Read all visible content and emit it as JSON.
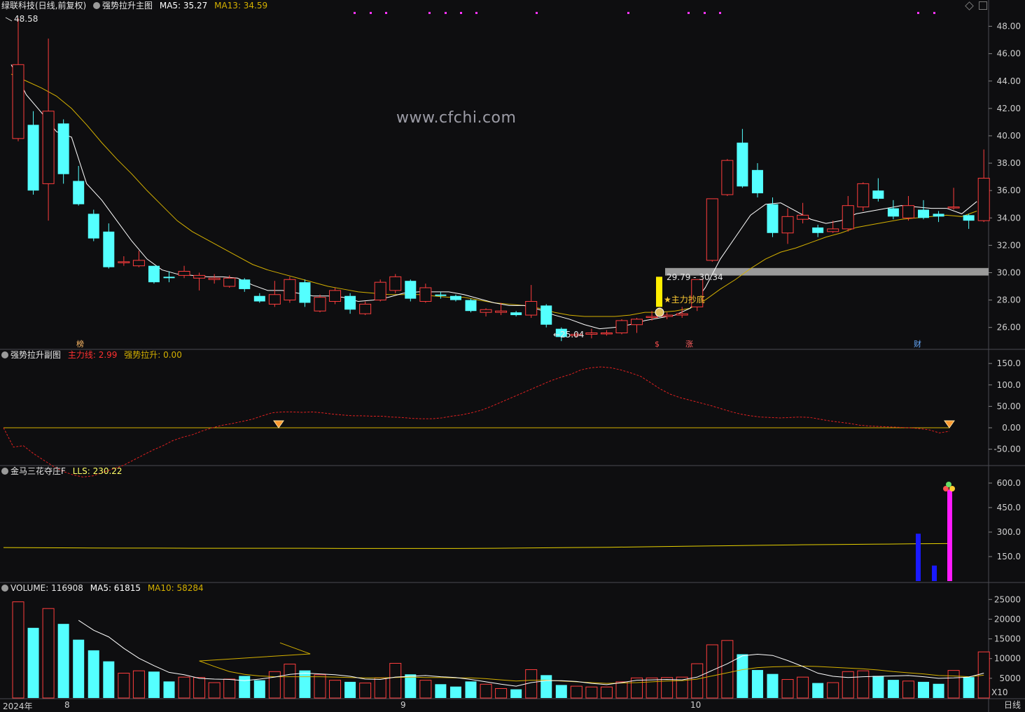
{
  "main_header": {
    "title": "绿联科技(日线,前复权)",
    "indicator": "强势拉升主图",
    "ma5": "MA5: 35.27",
    "ma13": "MA13: 34.59"
  },
  "sub1_header": {
    "title": "强势拉升副图",
    "line1": "主力线: 2.99",
    "line2": "强势拉升: 0.00"
  },
  "sub2_header": {
    "title": "金马三花夺庄F",
    "lls": "LLS: 230.22"
  },
  "vol_header": {
    "title": "VOLUME: 116908",
    "ma5": "MA5: 61815",
    "ma10": "MA10: 58284"
  },
  "watermark": "www.cfchi.com",
  "annotations": {
    "high": "48.58",
    "low": "25.04",
    "range": "29.79 - 30.34",
    "signal": "主力抄底",
    "mark_bang": "榜",
    "mark_s": "$",
    "mark_zhang": "涨",
    "mark_cai": "财"
  },
  "x_axis": {
    "year": "2024年",
    "m8": "8",
    "m9": "9",
    "m10": "10",
    "zoom": "X10",
    "period": "日线"
  },
  "axes": {
    "main": [
      "48.00",
      "46.00",
      "44.00",
      "42.00",
      "40.00",
      "38.00",
      "36.00",
      "34.00",
      "32.00",
      "30.00",
      "28.00",
      "26.00"
    ],
    "sub1": [
      "150.0",
      "100.0",
      "50.00",
      "0.00",
      "-50.00"
    ],
    "sub2": [
      "600.0",
      "450.0",
      "300.0",
      "150.0"
    ],
    "vol": [
      "25000",
      "20000",
      "15000",
      "10000",
      "5000"
    ]
  },
  "colors": {
    "up": "#ff3d3d",
    "down": "#54ffff",
    "ma5": "#ffffff",
    "ma13": "#d4b000",
    "bg": "#0e0e10",
    "grid": "#3a3a44"
  },
  "chart_data": {
    "type": "candlestick",
    "price_range": [
      24.5,
      49.0
    ],
    "candles": [
      [
        39.8,
        45.2,
        48.6,
        39.6
      ],
      [
        40.8,
        36.0,
        41.8,
        35.7
      ],
      [
        36.5,
        41.8,
        47.1,
        33.8
      ],
      [
        40.9,
        37.2,
        41.2,
        36.5
      ],
      [
        36.7,
        35.0,
        37.8,
        34.9
      ],
      [
        34.3,
        32.5,
        34.6,
        32.3
      ],
      [
        33.0,
        30.4,
        33.6,
        30.3
      ],
      [
        30.8,
        30.8,
        31.2,
        30.5
      ],
      [
        30.5,
        30.9,
        31.6,
        30.4
      ],
      [
        30.5,
        29.3,
        30.5,
        29.2
      ],
      [
        29.7,
        29.6,
        30.1,
        29.3
      ],
      [
        29.8,
        30.1,
        30.5,
        29.6
      ],
      [
        29.6,
        29.8,
        30.0,
        28.7
      ],
      [
        29.5,
        29.6,
        29.9,
        29.2
      ],
      [
        29.0,
        29.6,
        29.8,
        28.9
      ],
      [
        29.5,
        28.8,
        29.6,
        28.6
      ],
      [
        28.3,
        27.9,
        28.5,
        27.8
      ],
      [
        27.7,
        28.4,
        29.4,
        27.5
      ],
      [
        28.0,
        29.5,
        29.7,
        27.8
      ],
      [
        29.3,
        27.8,
        29.5,
        27.5
      ],
      [
        27.2,
        28.2,
        28.4,
        27.1
      ],
      [
        27.9,
        28.7,
        28.9,
        27.7
      ],
      [
        28.3,
        27.3,
        28.5,
        27.0
      ],
      [
        27.0,
        27.7,
        27.9,
        26.9
      ],
      [
        28.0,
        29.3,
        29.5,
        27.9
      ],
      [
        28.7,
        29.7,
        29.9,
        28.5
      ],
      [
        29.4,
        28.1,
        29.5,
        27.9
      ],
      [
        27.9,
        28.9,
        29.2,
        27.8
      ],
      [
        28.4,
        28.3,
        28.6,
        28.1
      ],
      [
        28.3,
        28.0,
        28.4,
        27.9
      ],
      [
        28.0,
        27.2,
        28.1,
        27.1
      ],
      [
        27.1,
        27.3,
        27.4,
        26.8
      ],
      [
        27.1,
        27.2,
        27.8,
        26.9
      ],
      [
        27.1,
        26.9,
        27.2,
        26.8
      ],
      [
        26.9,
        27.9,
        29.1,
        26.7
      ],
      [
        27.6,
        26.2,
        27.7,
        26.0
      ],
      [
        25.9,
        25.3,
        26.0,
        25.0
      ],
      [
        25.4,
        25.5,
        25.6,
        25.3
      ],
      [
        25.5,
        25.6,
        25.9,
        25.2
      ],
      [
        25.6,
        25.6,
        25.8,
        25.4
      ],
      [
        25.6,
        26.5,
        26.6,
        25.5
      ],
      [
        26.2,
        26.6,
        26.7,
        25.6
      ],
      [
        26.8,
        26.8,
        27.2,
        26.5
      ],
      [
        26.8,
        26.9,
        27.1,
        26.6
      ],
      [
        26.9,
        27.0,
        27.5,
        26.7
      ],
      [
        27.5,
        29.5,
        29.5,
        27.2
      ],
      [
        30.9,
        35.4,
        35.4,
        30.8
      ],
      [
        35.7,
        38.2,
        38.3,
        35.6
      ],
      [
        39.5,
        36.3,
        40.5,
        36.2
      ],
      [
        37.5,
        35.8,
        38.0,
        35.5
      ],
      [
        35.0,
        32.9,
        35.5,
        32.6
      ],
      [
        32.9,
        34.1,
        34.7,
        32.1
      ],
      [
        33.9,
        34.2,
        35.1,
        33.6
      ],
      [
        33.3,
        32.9,
        33.5,
        32.6
      ],
      [
        33.0,
        33.2,
        33.8,
        32.9
      ],
      [
        33.2,
        34.9,
        35.6,
        33.0
      ],
      [
        34.8,
        36.5,
        36.6,
        34.5
      ],
      [
        36.0,
        35.4,
        36.9,
        35.2
      ],
      [
        34.7,
        34.1,
        35.3,
        33.9
      ],
      [
        34.0,
        34.9,
        35.6,
        33.8
      ],
      [
        34.6,
        34.0,
        35.3,
        33.9
      ],
      [
        34.3,
        34.1,
        34.5,
        33.7
      ],
      [
        34.8,
        34.8,
        36.2,
        34.6
      ],
      [
        34.2,
        33.8,
        34.3,
        33.2
      ],
      [
        33.8,
        36.9,
        39.0,
        33.7
      ]
    ],
    "ma5": [
      45.2,
      43.0,
      41.7,
      40.3,
      39.9,
      36.5,
      35.3,
      33.8,
      32.3,
      31.0,
      30.2,
      29.9,
      29.8,
      29.7,
      29.7,
      29.6,
      29.1,
      28.7,
      28.7,
      28.5,
      28.3,
      28.3,
      28.2,
      27.9,
      28.0,
      28.2,
      28.5,
      28.6,
      28.6,
      28.6,
      28.4,
      28.1,
      27.8,
      27.6,
      27.6,
      27.3,
      26.9,
      26.6,
      26.2,
      25.9,
      26.0,
      26.2,
      26.5,
      26.7,
      26.9,
      27.4,
      28.9,
      31.0,
      32.6,
      34.2,
      35.0,
      35.1,
      34.5,
      33.9,
      33.6,
      33.8,
      34.3,
      34.5,
      34.7,
      34.9,
      34.8,
      34.7,
      34.7,
      34.3,
      35.2
    ],
    "ma13": [
      44.5,
      44.0,
      43.5,
      42.9,
      42.0,
      40.8,
      39.5,
      38.3,
      37.2,
      36.0,
      34.9,
      33.8,
      33.0,
      32.4,
      31.8,
      31.2,
      30.6,
      30.2,
      29.9,
      29.6,
      29.3,
      29.0,
      28.8,
      28.6,
      28.5,
      28.4,
      28.4,
      28.4,
      28.3,
      28.2,
      28.2,
      28.0,
      27.8,
      27.7,
      27.6,
      27.4,
      27.1,
      26.9,
      26.8,
      26.8,
      26.8,
      26.9,
      27.1,
      27.1,
      27.2,
      27.4,
      28.0,
      28.8,
      29.5,
      30.3,
      31.0,
      31.5,
      31.8,
      32.2,
      32.6,
      32.9,
      33.3,
      33.5,
      33.7,
      33.9,
      34.0,
      34.1,
      34.2,
      34.1,
      34.5
    ],
    "sub1_range": [
      -80,
      165
    ],
    "zhuli": [
      0,
      -45,
      -42,
      -60,
      -75,
      -90,
      -102,
      -110,
      -115,
      -112,
      -104,
      -96,
      -88,
      -76,
      -64,
      -52,
      -42,
      -30,
      -22,
      -16,
      -7,
      0,
      6,
      10,
      15,
      20,
      28,
      35,
      37,
      37,
      36,
      37,
      35,
      32,
      30,
      28,
      28,
      27,
      27,
      25,
      24,
      22,
      21,
      21,
      23,
      27,
      30,
      35,
      41,
      50,
      60,
      70,
      80,
      90,
      100,
      110,
      118,
      125,
      135,
      140,
      142,
      140,
      135,
      128,
      120,
      105,
      90,
      78,
      70,
      64,
      58,
      52,
      45,
      38,
      32,
      28,
      25,
      24,
      23,
      24,
      25,
      24,
      20,
      16,
      13,
      10,
      6,
      4,
      3,
      2,
      1,
      0,
      -2,
      -5,
      -12,
      -8
    ],
    "sub2_range": [
      0,
      660
    ],
    "lls_line": [
      205,
      204,
      203,
      202,
      202,
      201,
      201,
      201,
      201,
      200,
      200,
      200,
      200,
      201,
      203,
      205,
      207,
      210,
      213,
      216,
      219,
      222,
      224,
      226,
      228,
      230
    ],
    "sub2_bars": [
      [
        1311,
        290,
        "#1a1aff"
      ],
      [
        1334,
        95,
        "#1a1aff"
      ],
      [
        1356,
        560,
        "#ff1aff"
      ]
    ],
    "volume_range": [
      0,
      27000
    ],
    "volume": [
      24400,
      17800,
      22700,
      18800,
      14800,
      12100,
      9300,
      6300,
      6900,
      6700,
      4200,
      5300,
      5200,
      3900,
      4800,
      5600,
      4500,
      6700,
      8600,
      7000,
      5900,
      4500,
      4100,
      3800,
      5100,
      8800,
      6000,
      4500,
      3500,
      2900,
      4200,
      3500,
      2400,
      2200,
      7200,
      5800,
      3300,
      3000,
      2800,
      2800,
      4100,
      5100,
      5100,
      5200,
      5300,
      8700,
      13500,
      14600,
      11100,
      7100,
      6100,
      4700,
      5300,
      3800,
      3900,
      6700,
      6900,
      5600,
      4600,
      4300,
      4100,
      3600,
      7000,
      5300,
      11700
    ],
    "vol_ma5": [
      null,
      null,
      null,
      null,
      19700,
      17200,
      15500,
      12600,
      10100,
      8200,
      6500,
      5900,
      5000,
      4800,
      4700,
      4400,
      4800,
      5300,
      6000,
      6300,
      6100,
      5900,
      5500,
      4800,
      4700,
      5300,
      5500,
      5700,
      5400,
      5200,
      4700,
      4100,
      3500,
      3000,
      3900,
      4400,
      4400,
      4200,
      3700,
      3400,
      3900,
      4500,
      4600,
      4700,
      4600,
      5300,
      7000,
      8700,
      10700,
      11100,
      10800,
      9500,
      8000,
      6300,
      5500,
      5200,
      5400,
      5500,
      5600,
      5700,
      5400,
      5000,
      5100,
      5300,
      6300
    ],
    "vol_ma10": [
      null,
      null,
      null,
      null,
      null,
      null,
      null,
      null,
      null,
      14000,
      12600,
      11200,
      9400,
      8000,
      6700,
      6000,
      5600,
      5400,
      5400,
      5400,
      5400,
      5300,
      5200,
      5100,
      5100,
      5200,
      5300,
      5200,
      5200,
      5100,
      5100,
      4900,
      4600,
      4300,
      4500,
      4500,
      4300,
      4100,
      3900,
      3700,
      3800,
      3900,
      4100,
      4300,
      4400,
      4800,
      5600,
      6400,
      7200,
      7700,
      7900,
      8000,
      8100,
      8000,
      7800,
      7600,
      7400,
      7100,
      6700,
      6400,
      6100,
      5700,
      5600,
      5400,
      5800
    ]
  }
}
